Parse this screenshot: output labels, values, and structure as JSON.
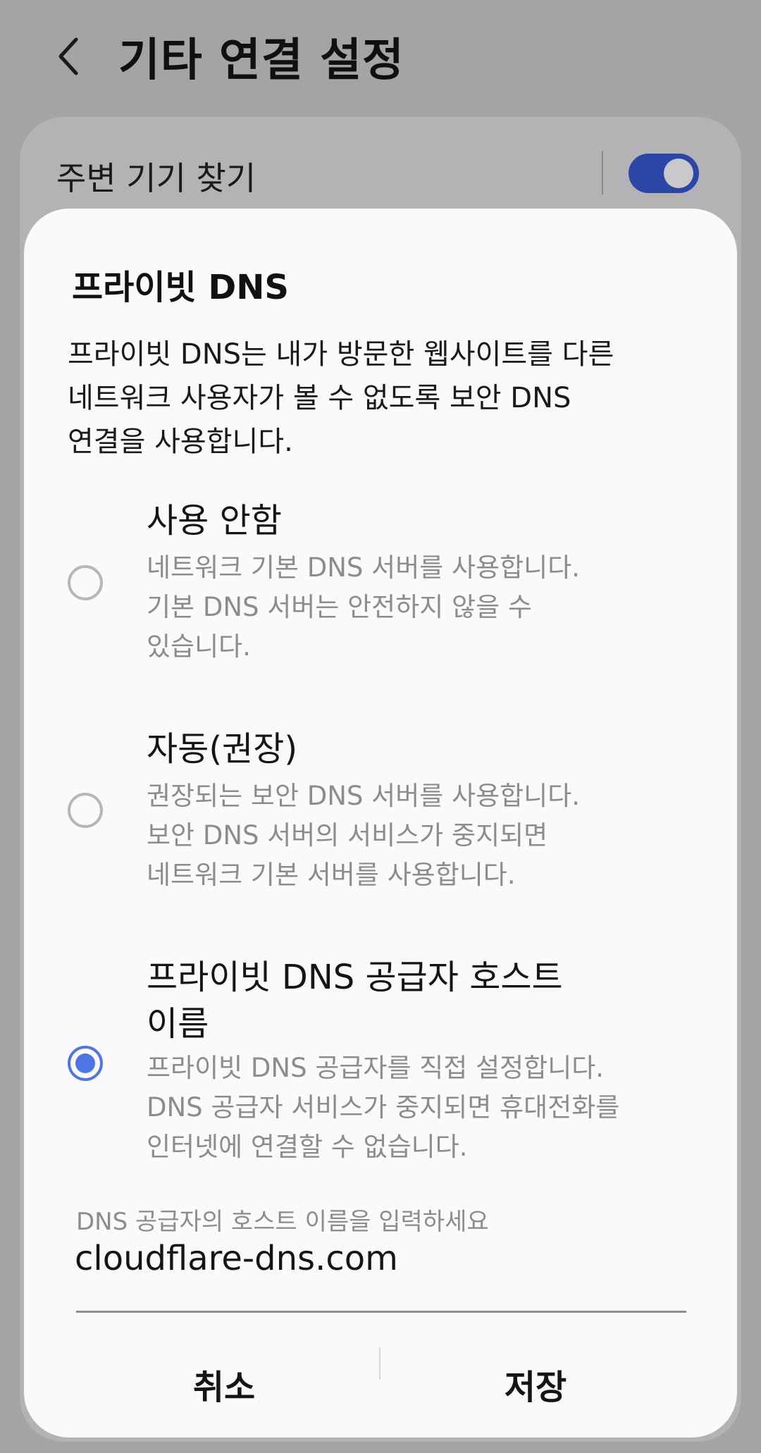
{
  "header": {
    "title": "기타 연결 설정",
    "back_icon": "chevron-left-icon"
  },
  "background": {
    "nearby_devices_label": "주변 기기 찾기",
    "nearby_devices_toggle": "on",
    "toggle_color": "#2a46a6"
  },
  "dialog": {
    "title": "프라이빗 DNS",
    "description": "프라이빗 DNS는 내가 방문한 웹사이트를 다른\n네트워크 사용자가 볼 수 없도록 보안 DNS\n연결을 사용합니다.",
    "options": [
      {
        "title": "사용 안함",
        "description": "네트워크 기본 DNS 서버를 사용합니다.\n기본 DNS 서버는 안전하지 않을 수\n있습니다.",
        "selected": false
      },
      {
        "title": "자동(권장)",
        "description": "권장되는 보안 DNS 서버를 사용합니다.\n보안 DNS 서버의 서비스가 중지되면\n네트워크 기본 서버를 사용합니다.",
        "selected": false
      },
      {
        "title": "프라이빗 DNS 공급자 호스트 이름",
        "description": "프라이빗 DNS 공급자를 직접 설정합니다.\nDNS 공급자 서비스가 중지되면 휴대전화를\n인터넷에 연결할 수 없습니다.",
        "selected": true
      }
    ],
    "hostname_input": {
      "label": "DNS 공급자의 호스트 이름을 입력하세요",
      "value": "cloudflare-dns.com"
    },
    "buttons": {
      "cancel": "취소",
      "save": "저장"
    },
    "accent_color": "#4e75e8"
  }
}
